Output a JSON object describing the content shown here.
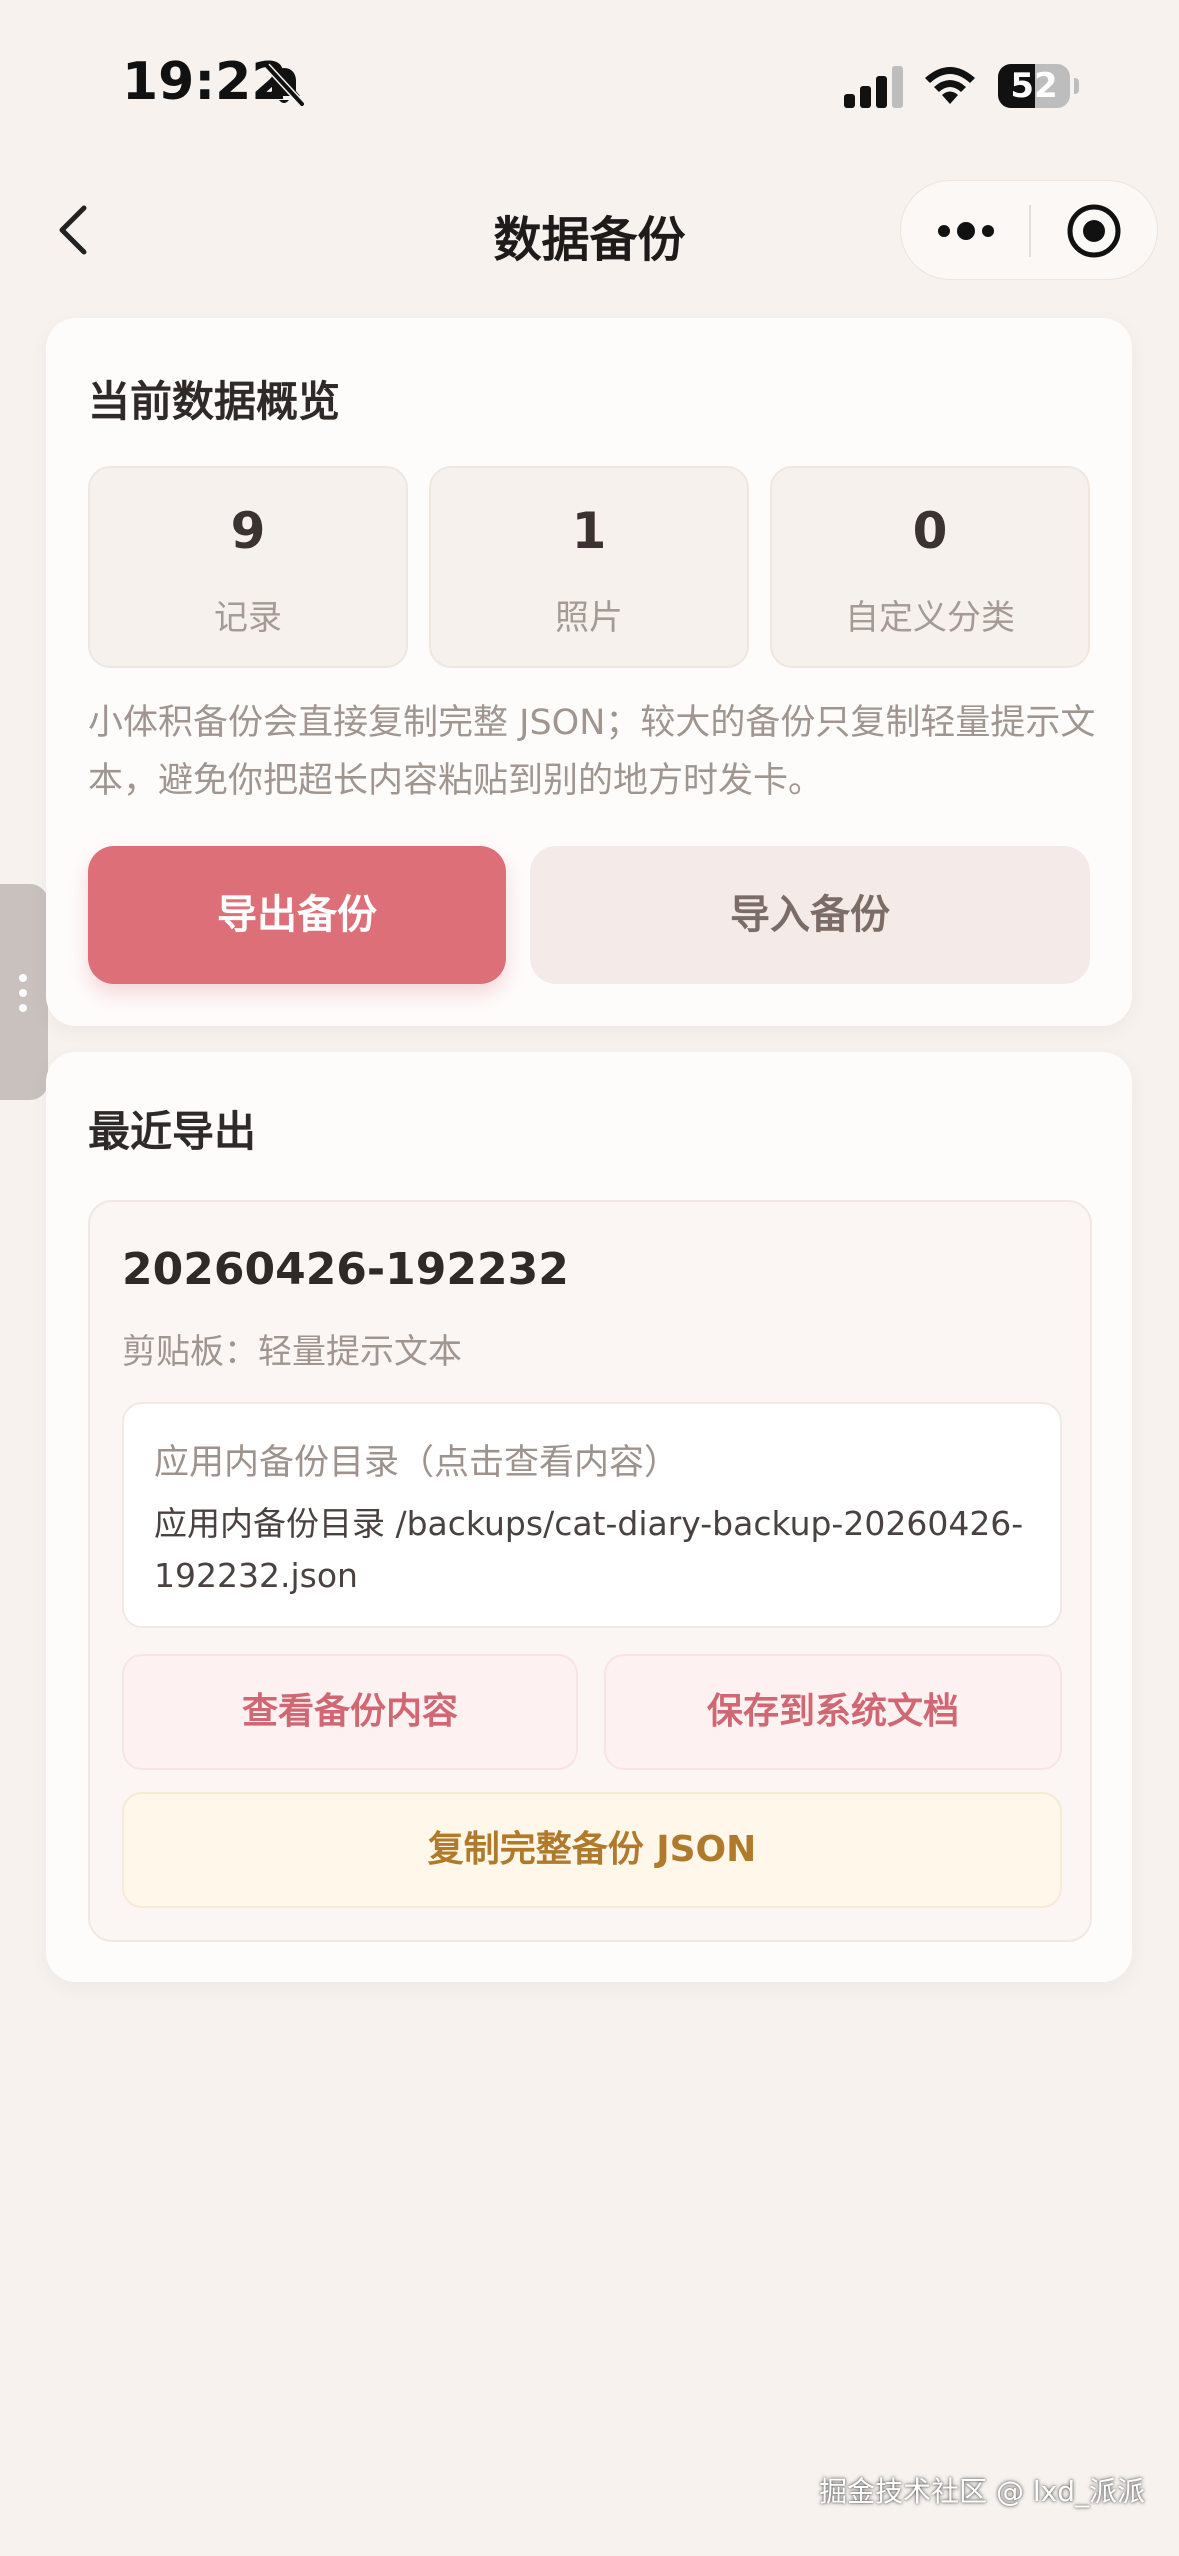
{
  "status_bar": {
    "time": "19:22",
    "battery": "52",
    "battery_level_pct": 52
  },
  "nav": {
    "title": "数据备份",
    "back_icon": "chevron-left-icon",
    "more_icon": "more-dots-icon",
    "close_icon": "target-close-icon"
  },
  "overview": {
    "title": "当前数据概览",
    "stats": [
      {
        "value": "9",
        "label": "记录"
      },
      {
        "value": "1",
        "label": "照片"
      },
      {
        "value": "0",
        "label": "自定义分类"
      }
    ],
    "hint": "小体积备份会直接复制完整 JSON；较大的备份只复制轻量提示文本，避免你把超长内容粘贴到别的地方时发卡。",
    "export_button": "导出备份",
    "import_button": "导入备份"
  },
  "recent": {
    "title": "最近导出",
    "export_id": "20260426-192232",
    "clipboard_label": "剪贴板：",
    "clipboard_value": "轻量提示文本",
    "dir_title": "应用内备份目录（点击查看内容）",
    "dir_path": "应用内备份目录 /backups/cat-diary-backup-20260426-192232.json",
    "view_button": "查看备份内容",
    "save_button": "保存到系统文档",
    "copy_button": "复制完整备份 JSON"
  },
  "watermark": "掘金技术社区 @ lxd_派派",
  "colors": {
    "background": "#f7f2ee",
    "accent": "#dd6f79",
    "copy_button_text": "#b07a2c"
  }
}
